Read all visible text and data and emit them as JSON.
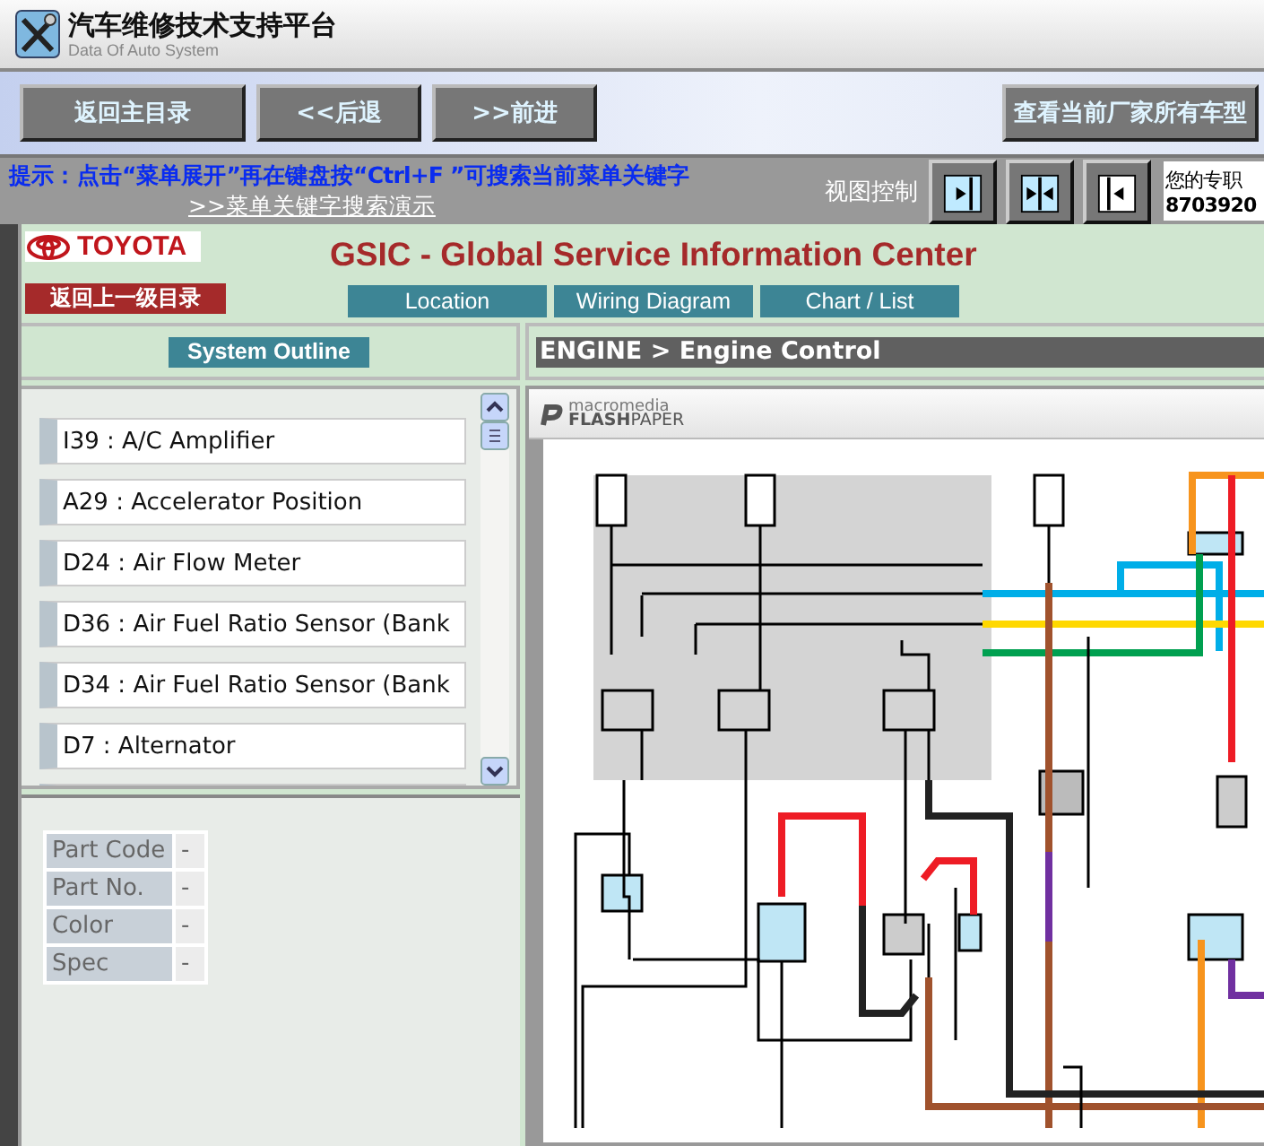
{
  "app": {
    "title": "汽车维修技术支持平台",
    "subtitle": "Data Of Auto System"
  },
  "toolbar": {
    "buttons": [
      "返回主目录",
      "<<后退",
      ">>前进"
    ],
    "right_button": "查看当前厂家所有车型"
  },
  "hint": {
    "text": "提示：点击“菜单展开”再在键盘按“Ctrl+F ”可搜索当前菜单关键字",
    "link": ">>菜单关键字搜索演示",
    "view_label": "视图控制",
    "view_buttons": [
      {
        "kind": "right"
      },
      {
        "kind": "split"
      },
      {
        "kind": "left"
      }
    ],
    "contact": [
      "您的专职",
      "8703920"
    ]
  },
  "brand": {
    "logo": "TOYOTA",
    "back_button": "返回上一级目录",
    "title": "GSIC - Global Service Information Center",
    "tabs": [
      "Location",
      "Wiring Diagram",
      "Chart / List"
    ]
  },
  "outline": {
    "header": "System Outline",
    "items": [
      "I39 : A/C Amplifier",
      "A29 : Accelerator Position",
      "D24 : Air Flow Meter",
      "D36 : Air Fuel Ratio Sensor (Bank",
      "D34 : Air Fuel Ratio Sensor (Bank",
      "D7 : Alternator"
    ]
  },
  "parts": {
    "labels": [
      "Part Code",
      "Part No.",
      "Color",
      "Spec"
    ],
    "values": [
      "-",
      "-",
      "-",
      "-"
    ]
  },
  "viewer": {
    "breadcrumb": "ENGINE > Engine Control",
    "plugin_name": "macromedia",
    "plugin_product": "**FLASH**PAPER"
  }
}
